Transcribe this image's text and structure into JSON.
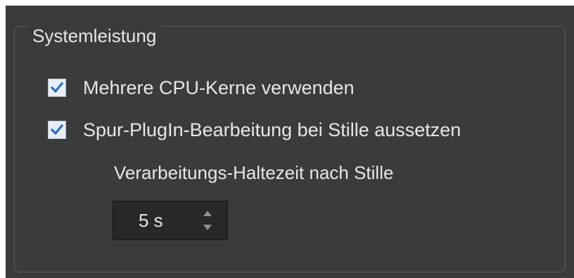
{
  "group": {
    "title": "Systemleistung"
  },
  "options": [
    {
      "label": "Mehrere CPU-Kerne verwenden",
      "checked": true
    },
    {
      "label": "Spur-PlugIn-Bearbeitung bei Stille aussetzen",
      "checked": true
    }
  ],
  "hold_time": {
    "label": "Verarbeitungs-Haltezeit nach Stille",
    "value": "5 s"
  },
  "icons": {
    "checkmark": "checkmark-icon",
    "spin_up": "triangle-up-icon",
    "spin_down": "triangle-down-icon"
  },
  "colors": {
    "panel_background": "#3b3b3b",
    "text": "#e6e6e6",
    "checkbox_fill": "#e8eef6",
    "checkmark": "#2a6fc7",
    "spinbox_background": "#282828"
  }
}
